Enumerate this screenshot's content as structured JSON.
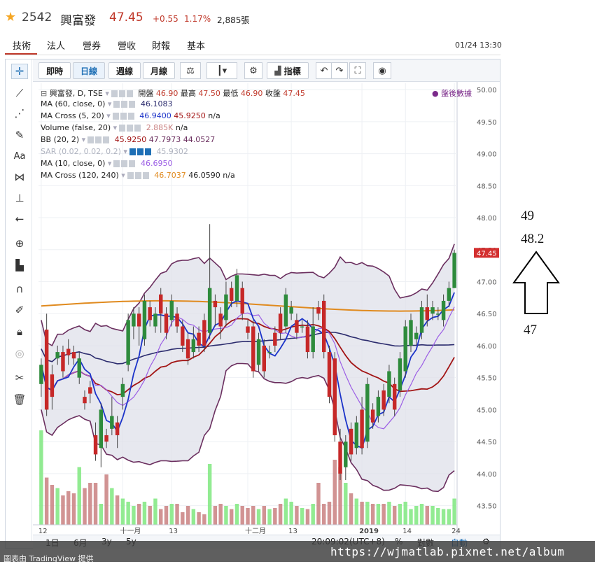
{
  "header": {
    "star_icon": "star-icon",
    "code": "2542",
    "name": "興富發",
    "price": "47.45",
    "change": "+0.55",
    "percent": "1.17%",
    "volume": "2,885張"
  },
  "nav": {
    "tabs": [
      "技術",
      "法人",
      "營券",
      "營收",
      "財報",
      "基本"
    ],
    "active_index": 0,
    "datetime": "01/24 13:30"
  },
  "toolbar": {
    "periods": [
      "即時",
      "日線",
      "週線",
      "月線"
    ],
    "active_period": "日線",
    "indicators_label": "指標",
    "icons": [
      "compare-icon",
      "candle-style-icon",
      "settings-icon",
      "indicators-icon",
      "undo-icon",
      "redo-icon",
      "fullscreen-icon",
      "camera-icon"
    ]
  },
  "left_tools": [
    "crosshair-icon",
    "trendline-icon",
    "fib-icon",
    "brush-icon",
    "text-icon",
    "pattern-icon",
    "measure-icon",
    "arrow-left-icon",
    "zoom-icon",
    "ruler-icon",
    "magnet-icon",
    "lock-draw-icon",
    "lock-icon",
    "eye-icon",
    "remove-icon",
    "trash-icon"
  ],
  "legend": {
    "main": {
      "title": "興富發, D, TSE",
      "open_label": "開盤",
      "open": "46.90",
      "high_label": "最高",
      "high": "47.50",
      "low_label": "最低",
      "low": "46.90",
      "close_label": "收盤",
      "close": "47.45"
    },
    "after_hours": "盤後數據",
    "lines": [
      {
        "label": "MA (60, close, 0)",
        "v1": "46.1083",
        "v2": "",
        "v3": ""
      },
      {
        "label": "MA Cross (5, 20)",
        "v1": "46.9400",
        "v2": "45.9250",
        "v3": "n/a"
      },
      {
        "label": "Volume (false, 20)",
        "v1": "2.885K",
        "v2": "n/a",
        "v3": ""
      },
      {
        "label": "BB (20, 2)",
        "v1": "45.9250",
        "v2": "47.7973",
        "v3": "44.0527"
      },
      {
        "label": "SAR (0.02, 0.02, 0.2)",
        "v1": "45.9302",
        "v2": "",
        "v3": ""
      },
      {
        "label": "MA (10, close, 0)",
        "v1": "46.6950",
        "v2": "",
        "v3": ""
      },
      {
        "label": "MA Cross (120, 240)",
        "v1": "46.7037",
        "v2": "46.0590",
        "v3": "n/a"
      }
    ]
  },
  "price_axis": [
    "50.00",
    "49.50",
    "49.00",
    "48.50",
    "48.00",
    "47.50",
    "47.00",
    "46.50",
    "46.00",
    "45.50",
    "45.00",
    "44.50",
    "44.00",
    "43.50"
  ],
  "last_price_tag": "47.45",
  "time_axis": [
    "12",
    "十一月",
    "13",
    "十二月",
    "13",
    "2019",
    "14",
    "24"
  ],
  "bottom": {
    "ranges": [
      "1日",
      "6月",
      "3y",
      "5y"
    ],
    "time": "20:09:02",
    "tz": "(UTC+8)",
    "percent": "%",
    "log": "對數",
    "auto": "自動"
  },
  "footer": {
    "provider": "圖表由 TradingView 提供",
    "url": "https://wjmatlab.pixnet.net/album"
  },
  "annotations": {
    "top": "49",
    "mid": "48.2",
    "bottom": "47"
  },
  "chart_data": {
    "type": "candlestick",
    "price_range": [
      43.2,
      50.1
    ],
    "candles": [
      {
        "o": 45.4,
        "c": 45.7,
        "h": 45.8,
        "l": 45.2
      },
      {
        "o": 46.25,
        "c": 45.0,
        "h": 46.5,
        "l": 44.9
      },
      {
        "o": 45.55,
        "c": 45.2,
        "h": 45.7,
        "l": 45.0
      },
      {
        "o": 45.8,
        "c": 45.9,
        "h": 46.0,
        "l": 45.7
      },
      {
        "o": 45.9,
        "c": 45.6,
        "h": 46.0,
        "l": 45.5
      },
      {
        "o": 45.95,
        "c": 45.85,
        "h": 46.1,
        "l": 45.7
      },
      {
        "o": 45.9,
        "c": 45.8,
        "h": 46.0,
        "l": 45.7
      },
      {
        "o": 45.5,
        "c": 45.8,
        "h": 45.9,
        "l": 45.4
      },
      {
        "o": 45.2,
        "c": 45.1,
        "h": 45.3,
        "l": 45.0
      },
      {
        "o": 45.35,
        "c": 45.25,
        "h": 45.45,
        "l": 45.1
      },
      {
        "o": 44.6,
        "c": 44.3,
        "h": 44.8,
        "l": 44.2
      },
      {
        "o": 44.4,
        "c": 45.0,
        "h": 45.1,
        "l": 44.1
      },
      {
        "o": 44.6,
        "c": 44.5,
        "h": 44.7,
        "l": 44.4
      },
      {
        "o": 44.7,
        "c": 44.9,
        "h": 45.2,
        "l": 44.6
      },
      {
        "o": 44.8,
        "c": 44.6,
        "h": 44.9,
        "l": 44.4
      },
      {
        "o": 45.2,
        "c": 45.4,
        "h": 45.5,
        "l": 45.0
      },
      {
        "o": 45.7,
        "c": 46.4,
        "h": 46.5,
        "l": 45.6
      },
      {
        "o": 46.3,
        "c": 46.5,
        "h": 46.6,
        "l": 46.1
      },
      {
        "o": 46.5,
        "c": 46.3,
        "h": 46.6,
        "l": 46.0
      },
      {
        "o": 46.1,
        "c": 46.7,
        "h": 46.8,
        "l": 46.0
      },
      {
        "o": 46.6,
        "c": 46.4,
        "h": 46.7,
        "l": 46.3
      },
      {
        "o": 46.3,
        "c": 46.5,
        "h": 46.6,
        "l": 46.2
      },
      {
        "o": 46.8,
        "c": 46.5,
        "h": 46.9,
        "l": 46.2
      },
      {
        "o": 46.5,
        "c": 46.2,
        "h": 46.6,
        "l": 46.1
      },
      {
        "o": 46.4,
        "c": 46.7,
        "h": 46.8,
        "l": 46.3
      },
      {
        "o": 46.5,
        "c": 46.3,
        "h": 46.6,
        "l": 46.2
      },
      {
        "o": 46.3,
        "c": 46.0,
        "h": 46.4,
        "l": 45.9
      },
      {
        "o": 46.1,
        "c": 45.8,
        "h": 46.2,
        "l": 45.7
      },
      {
        "o": 45.9,
        "c": 46.1,
        "h": 46.3,
        "l": 45.8
      },
      {
        "o": 46.2,
        "c": 46.0,
        "h": 46.3,
        "l": 45.9
      },
      {
        "o": 46.4,
        "c": 46.0,
        "h": 46.5,
        "l": 45.9
      },
      {
        "o": 46.2,
        "c": 46.9,
        "h": 47.9,
        "l": 46.1
      },
      {
        "o": 46.7,
        "c": 46.6,
        "h": 46.8,
        "l": 46.3
      },
      {
        "o": 46.5,
        "c": 46.3,
        "h": 46.6,
        "l": 46.1
      },
      {
        "o": 46.4,
        "c": 46.8,
        "h": 47.0,
        "l": 46.3
      },
      {
        "o": 46.9,
        "c": 46.7,
        "h": 47.0,
        "l": 46.6
      },
      {
        "o": 46.7,
        "c": 47.1,
        "h": 47.2,
        "l": 46.6
      },
      {
        "o": 46.9,
        "c": 46.5,
        "h": 47.0,
        "l": 46.4
      },
      {
        "o": 46.3,
        "c": 46.2,
        "h": 46.4,
        "l": 46.1
      },
      {
        "o": 46.3,
        "c": 45.6,
        "h": 46.4,
        "l": 45.5
      },
      {
        "o": 45.7,
        "c": 46.1,
        "h": 46.2,
        "l": 45.6
      },
      {
        "o": 46.0,
        "c": 45.6,
        "h": 46.1,
        "l": 45.5
      },
      {
        "o": 45.9,
        "c": 45.9,
        "h": 46.0,
        "l": 45.8
      },
      {
        "o": 46.2,
        "c": 46.0,
        "h": 46.3,
        "l": 45.9
      },
      {
        "o": 46.5,
        "c": 46.2,
        "h": 46.6,
        "l": 46.1
      },
      {
        "o": 46.3,
        "c": 46.8,
        "h": 46.9,
        "l": 46.2
      },
      {
        "o": 46.5,
        "c": 46.6,
        "h": 46.7,
        "l": 46.4
      },
      {
        "o": 46.4,
        "c": 46.2,
        "h": 46.5,
        "l": 46.1
      },
      {
        "o": 46.3,
        "c": 46.3,
        "h": 46.4,
        "l": 46.2
      },
      {
        "o": 46.3,
        "c": 45.9,
        "h": 46.4,
        "l": 45.8
      },
      {
        "o": 45.9,
        "c": 46.3,
        "h": 46.6,
        "l": 45.8
      },
      {
        "o": 46.6,
        "c": 46.5,
        "h": 46.7,
        "l": 46.4
      },
      {
        "o": 46.7,
        "c": 45.9,
        "h": 46.8,
        "l": 45.8
      },
      {
        "o": 45.9,
        "c": 45.2,
        "h": 46.0,
        "l": 45.1
      },
      {
        "o": 45.8,
        "c": 44.6,
        "h": 45.9,
        "l": 44.5
      },
      {
        "o": 44.5,
        "c": 44.0,
        "h": 44.7,
        "l": 43.9
      },
      {
        "o": 44.1,
        "c": 44.5,
        "h": 44.6,
        "l": 43.9
      },
      {
        "o": 44.7,
        "c": 44.3,
        "h": 44.8,
        "l": 44.2
      },
      {
        "o": 44.4,
        "c": 44.8,
        "h": 44.9,
        "l": 44.3
      },
      {
        "o": 45.0,
        "c": 44.4,
        "h": 45.2,
        "l": 44.3
      },
      {
        "o": 44.5,
        "c": 45.4,
        "h": 45.5,
        "l": 44.4
      },
      {
        "o": 45.0,
        "c": 44.8,
        "h": 45.1,
        "l": 44.7
      },
      {
        "o": 44.9,
        "c": 45.2,
        "h": 45.3,
        "l": 44.8
      },
      {
        "o": 45.3,
        "c": 45.0,
        "h": 45.4,
        "l": 44.9
      },
      {
        "o": 45.2,
        "c": 45.6,
        "h": 45.7,
        "l": 45.1
      },
      {
        "o": 45.4,
        "c": 45.0,
        "h": 45.5,
        "l": 44.9
      },
      {
        "o": 45.3,
        "c": 45.8,
        "h": 45.9,
        "l": 45.2
      },
      {
        "o": 45.6,
        "c": 46.3,
        "h": 46.4,
        "l": 45.5
      },
      {
        "o": 46.0,
        "c": 46.4,
        "h": 46.5,
        "l": 45.9
      },
      {
        "o": 46.1,
        "c": 46.2,
        "h": 46.3,
        "l": 46.0
      },
      {
        "o": 46.2,
        "c": 46.6,
        "h": 46.7,
        "l": 46.1
      },
      {
        "o": 46.6,
        "c": 46.4,
        "h": 46.8,
        "l": 46.3
      },
      {
        "o": 46.5,
        "c": 46.6,
        "h": 46.7,
        "l": 46.4
      },
      {
        "o": 46.5,
        "c": 46.5,
        "h": 46.6,
        "l": 46.4
      },
      {
        "o": 46.4,
        "c": 46.7,
        "h": 46.8,
        "l": 46.3
      },
      {
        "o": 46.7,
        "c": 46.9,
        "h": 47.0,
        "l": 46.6
      },
      {
        "o": 46.9,
        "c": 47.45,
        "h": 47.5,
        "l": 46.9
      }
    ],
    "volume_max": 1.0,
    "volume": [
      0.9,
      0.45,
      0.38,
      0.35,
      0.28,
      0.32,
      0.3,
      0.55,
      0.35,
      0.4,
      0.4,
      0.2,
      0.48,
      0.35,
      0.28,
      0.25,
      0.22,
      0.18,
      0.2,
      0.22,
      0.18,
      0.25,
      0.15,
      0.18,
      0.2,
      0.2,
      0.12,
      0.18,
      0.15,
      0.12,
      0.1,
      0.58,
      0.18,
      0.2,
      0.18,
      0.15,
      0.2,
      0.18,
      0.16,
      0.18,
      0.15,
      0.18,
      0.15,
      0.16,
      0.2,
      0.25,
      0.22,
      0.18,
      0.16,
      0.15,
      0.2,
      0.4,
      0.2,
      0.22,
      0.62,
      0.55,
      0.4,
      0.3,
      0.25,
      0.22,
      0.22,
      0.2,
      0.2,
      0.2,
      0.22,
      0.18,
      0.2,
      0.22,
      0.15,
      0.18,
      0.2,
      0.18,
      0.18,
      0.16,
      0.15,
      0.15,
      0.25
    ],
    "volume_colors": {
      "up": "#7fe87f",
      "down": "#c98080"
    },
    "colors": {
      "up": "#2e8b3c",
      "down": "#c62828",
      "bb": "#6b2f5f",
      "ma_cross_fast": "#1b33c9",
      "ma_cross_slow": "#a21414",
      "ma60": "#2c2c6e",
      "ma120": "#e08a1e",
      "ma10": "#9b5de5",
      "bb_fill": "#dfe0ea"
    }
  }
}
